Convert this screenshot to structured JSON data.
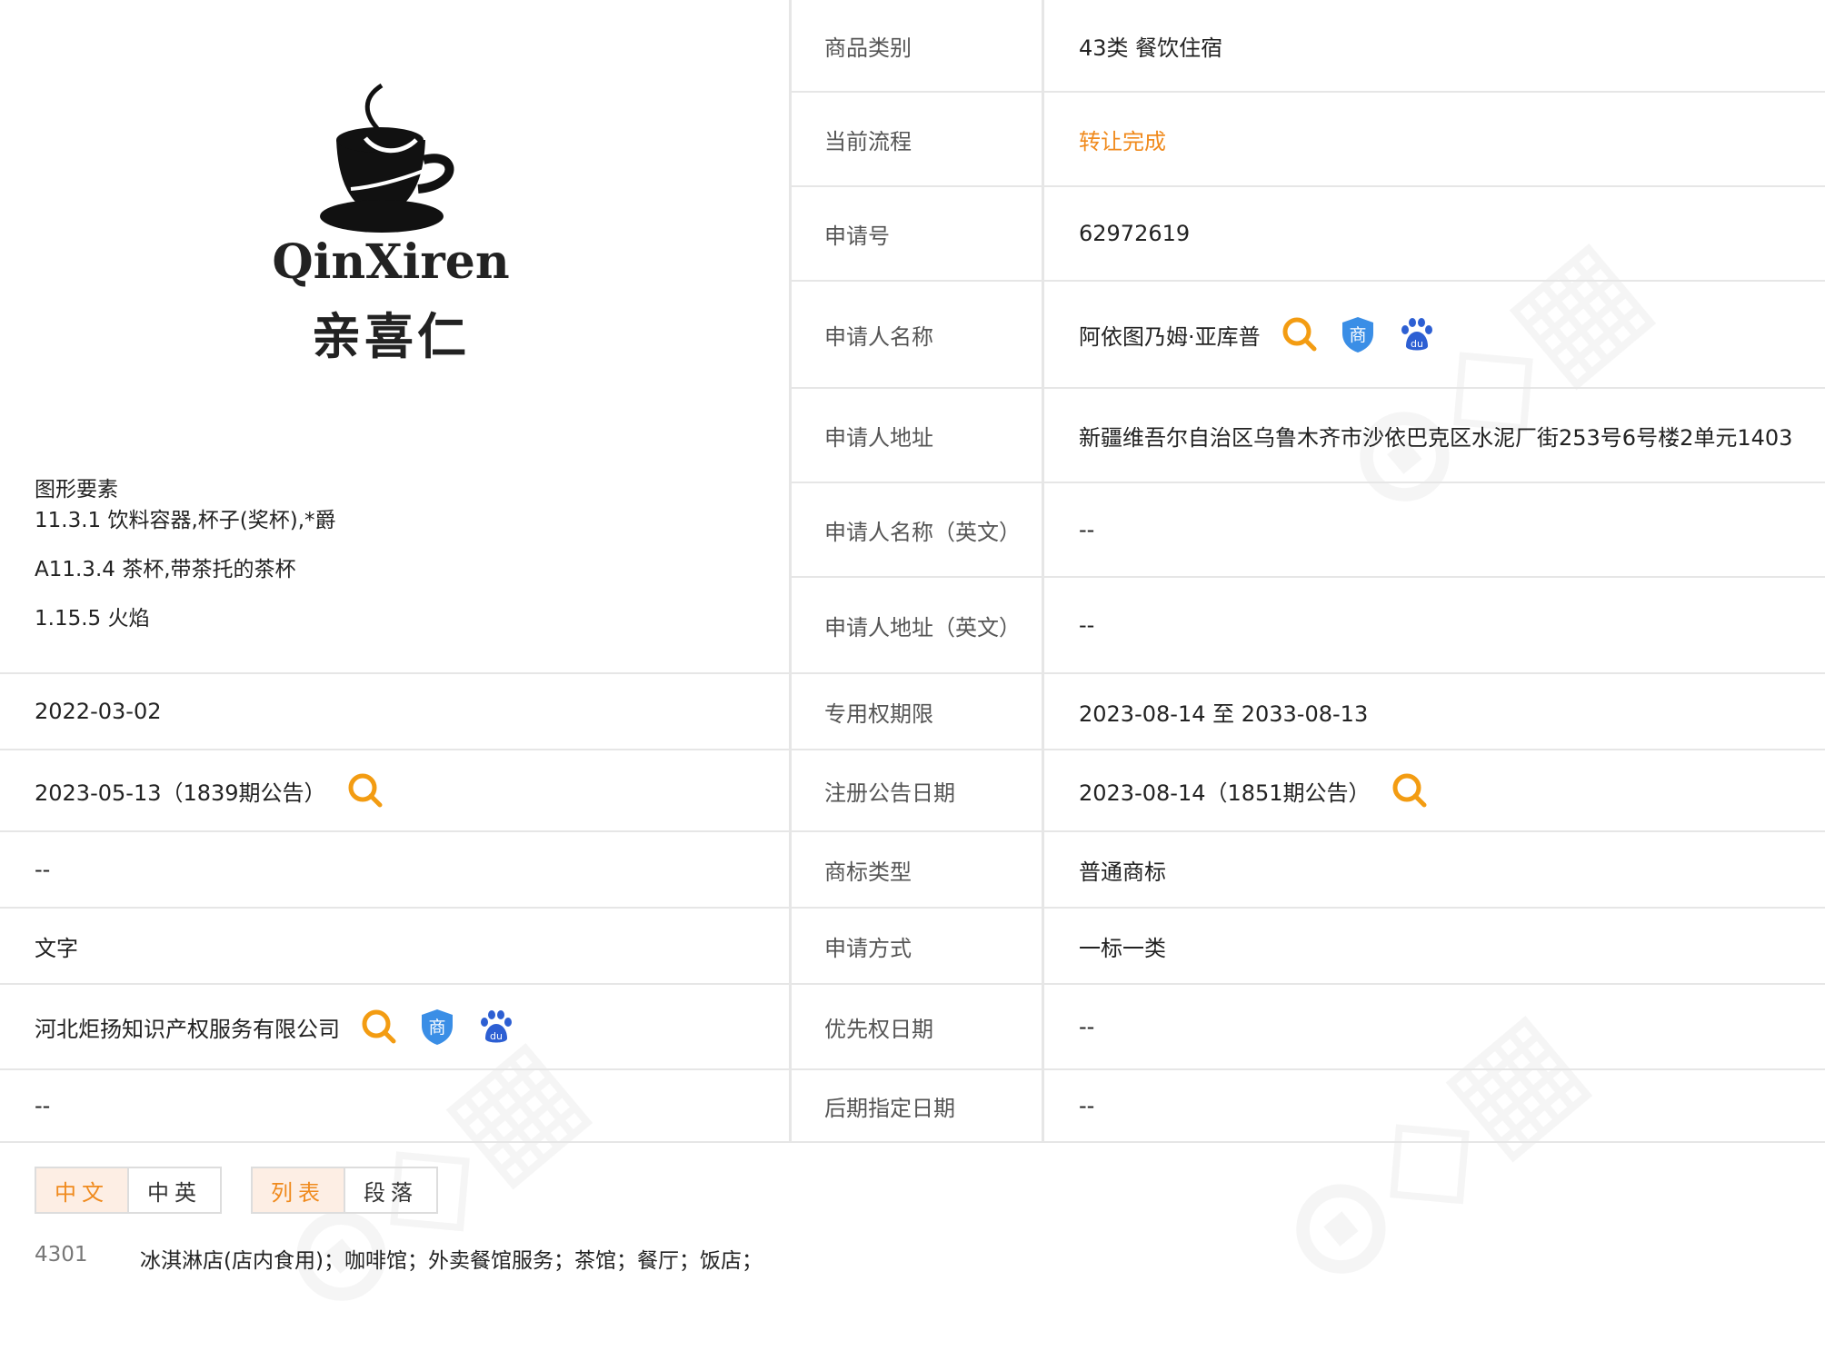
{
  "logo": {
    "text_en": "QinXiren",
    "text_cn": "亲喜仁"
  },
  "figure_elements": {
    "title": "图形要素",
    "items": [
      "11.3.1 饮料容器,杯子(奖杯),*爵",
      "A11.3.4 茶杯,带茶托的茶杯",
      "1.15.5 火焰"
    ]
  },
  "left_rows": {
    "apply_date": "2022-03-02",
    "prelim_announce": "2023-05-13（1839期公告）",
    "intl_reg_date": "--",
    "mark_form": "文字",
    "agent": "河北炬扬知识产权服务有限公司",
    "last": "--"
  },
  "right_rows": [
    {
      "label": "商品类别",
      "value": "43类 餐饮住宿"
    },
    {
      "label": "当前流程",
      "value": "转让完成"
    },
    {
      "label": "申请号",
      "value": "62972619"
    },
    {
      "label": "申请人名称",
      "value": "阿依图乃姆·亚库普"
    },
    {
      "label": "申请人地址",
      "value": "新疆维吾尔自治区乌鲁木齐市沙依巴克区水泥厂街253号6号楼2单元1403"
    },
    {
      "label": "申请人名称（英文）",
      "value": "--"
    },
    {
      "label": "申请人地址（英文）",
      "value": "--"
    },
    {
      "label": "专用权期限",
      "value": "2023-08-14 至 2033-08-13"
    },
    {
      "label": "注册公告日期",
      "value": "2023-08-14（1851期公告）"
    },
    {
      "label": "商标类型",
      "value": "普通商标"
    },
    {
      "label": "申请方式",
      "value": "一标一类"
    },
    {
      "label": "优先权日期",
      "value": "--"
    },
    {
      "label": "后期指定日期",
      "value": "--"
    }
  ],
  "buttons": {
    "cn": "中文",
    "cn_en": "中英",
    "list": "列表",
    "para": "段落"
  },
  "goods": {
    "code": "4301",
    "items": "冰淇淋店(店内食用)；咖啡馆；外卖餐馆服务；茶馆；餐厅；饭店；"
  },
  "colors": {
    "accent": "#f08a1d",
    "border": "#e6e6e6",
    "shield": "#3a8ee6",
    "baidu": "#2d5fd3"
  },
  "icons": [
    "search-icon",
    "shield-shang-icon",
    "baidu-paw-icon"
  ]
}
